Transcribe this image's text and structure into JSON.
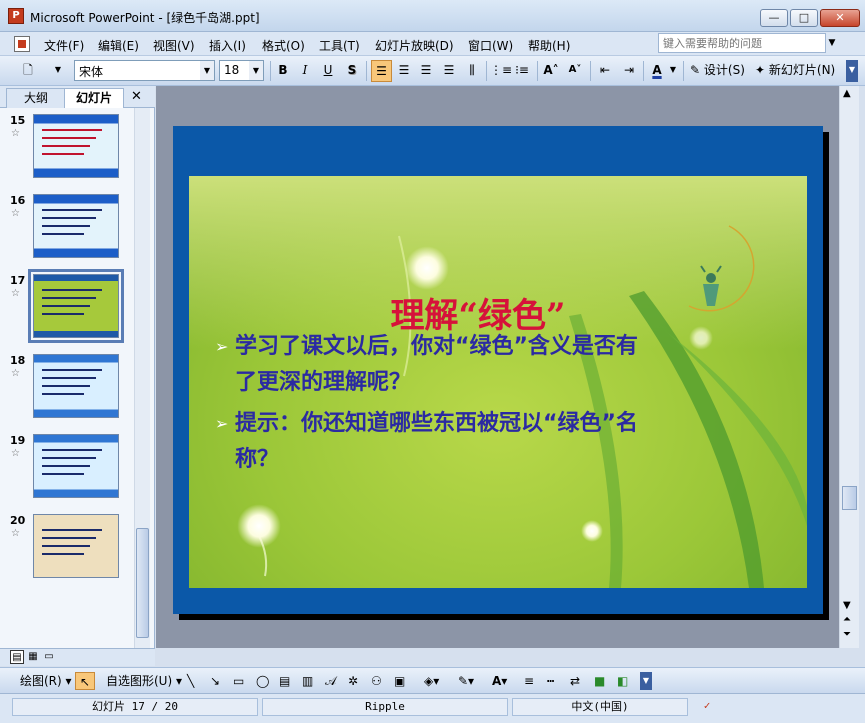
{
  "window": {
    "title": "Microsoft PowerPoint - [绿色千岛湖.ppt]",
    "min_symbol": "—",
    "max_symbol": "□",
    "close_symbol": "✕"
  },
  "menu": {
    "items": [
      "文件(F)",
      "编辑(E)",
      "视图(V)",
      "插入(I)",
      "格式(O)",
      "工具(T)",
      "幻灯片放映(D)",
      "窗口(W)",
      "帮助(H)"
    ],
    "help_placeholder": "键入需要帮助的问题"
  },
  "toolbar": {
    "font": "宋体",
    "size": "18",
    "bold": "B",
    "italic": "I",
    "underline": "U",
    "shadow": "S",
    "font_color": "A",
    "grow": "A˄",
    "shrink": "A˅",
    "design_label": "设计(S)",
    "new_slide_label": "新幻灯片(N)"
  },
  "left_pane": {
    "tab_outline": "大纲",
    "tab_slides": "幻灯片",
    "close": "✕",
    "slides": [
      {
        "number": "15",
        "style": "t-blue"
      },
      {
        "number": "16",
        "style": "t-blue"
      },
      {
        "number": "17",
        "style": "t-green",
        "selected": true
      },
      {
        "number": "18",
        "style": "t-sky"
      },
      {
        "number": "19",
        "style": "t-sky"
      },
      {
        "number": "20",
        "style": "t-last"
      }
    ],
    "star": "☆"
  },
  "slide": {
    "title": "理解“绿色”",
    "bullet_mark": "➢",
    "bullet1": "学习了课文以后，你对“绿色”含义是否有了更深的理解呢？",
    "bullet2": "提示：你还知道哪些东西被冠以“绿色”名称？",
    "colors": {
      "frame": "#0b58a8",
      "title": "#d6123a",
      "bullet": "#2b2aa2"
    }
  },
  "drawbar": {
    "draw_label": "绘图(R)",
    "autoshapes_label": "自选图形(U)"
  },
  "status": {
    "slide_pos": "幻灯片 17 / 20",
    "design": "Ripple",
    "language": "中文(中国)"
  },
  "icons": {
    "app": "powerpoint-icon",
    "spell": "spell-check-icon"
  }
}
